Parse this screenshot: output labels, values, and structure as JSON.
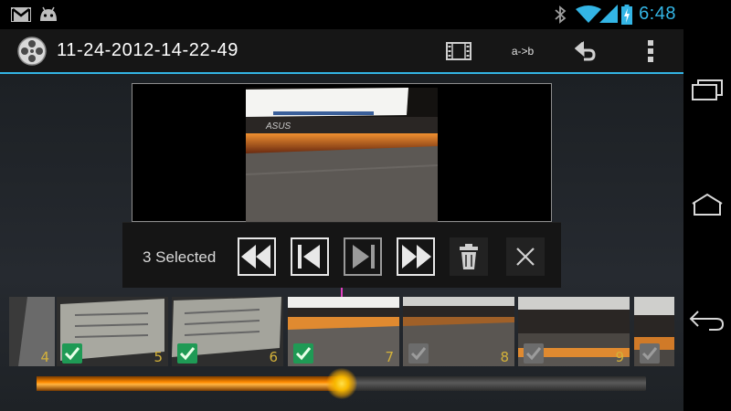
{
  "status_bar": {
    "time": "6:48",
    "icons": [
      "gmail-icon",
      "android-icon",
      "bluetooth-icon",
      "wifi-icon",
      "signal-icon",
      "battery-icon"
    ],
    "accent": "#33b5e5"
  },
  "action_bar": {
    "title": "11-24-2012-14-22-49",
    "ab_label": "a->b",
    "actions": [
      "filmstrip-icon",
      "a-to-b-button",
      "undo-icon",
      "overflow-menu-icon"
    ]
  },
  "selection_toolbar": {
    "count_text": "3 Selected",
    "buttons": [
      "rewind-icon",
      "skip-back-icon",
      "skip-forward-icon",
      "fast-forward-icon",
      "trash-icon",
      "close-icon"
    ]
  },
  "filmstrip": {
    "frames": [
      {
        "number": "4",
        "checked": null
      },
      {
        "number": "5",
        "checked": true
      },
      {
        "number": "6",
        "checked": true
      },
      {
        "number": "7",
        "checked": true
      },
      {
        "number": "8",
        "checked": false
      },
      {
        "number": "9",
        "checked": false
      },
      {
        "number": "",
        "checked": false
      }
    ]
  },
  "seek_bar": {
    "progress": 0.5,
    "color": "#ff9a00"
  },
  "nav_bar": {
    "buttons": [
      "recent-apps-icon",
      "home-icon",
      "back-icon"
    ]
  },
  "colors": {
    "accent": "#33b5e5",
    "frame_number": "#d4b23a",
    "check_on": "#1f9a55"
  }
}
